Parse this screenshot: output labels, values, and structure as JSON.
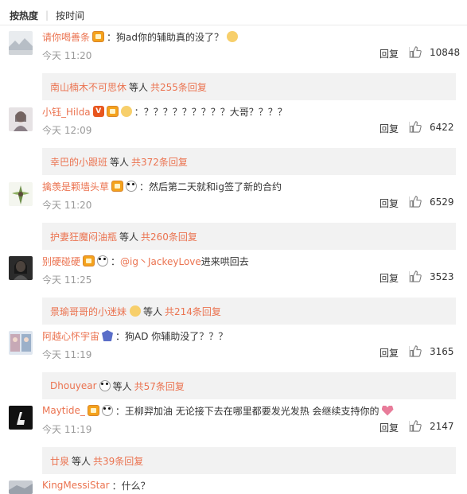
{
  "sort": {
    "hot": "按热度",
    "time": "按时间"
  },
  "reply_label": "回复",
  "comments": [
    {
      "username": "请你喝善条",
      "badges": [
        "vip-icon"
      ],
      "separator": "：",
      "text": "狗ad你的辅助真的没了？",
      "trailing_icon": "crying-emoji-icon",
      "time": "今天 11:20",
      "likes": "10848",
      "sub": {
        "names": "南山楠木不可思休",
        "mid": "等人",
        "count": "共255条回复",
        "emoji": ""
      }
    },
    {
      "username": "小钰_Hilda",
      "badges": [
        "v-verified-icon",
        "vip-icon",
        "star-badge-icon"
      ],
      "separator": "：",
      "text": "？？？？？？？？？大哥？？？？",
      "trailing_icon": "",
      "time": "今天 12:09",
      "likes": "6422",
      "sub": {
        "names": "幸巴的小跟班",
        "mid": "等人",
        "count": "共372条回复",
        "emoji": ""
      }
    },
    {
      "username": "擒羡是颗墙头草",
      "badges": [
        "vip-icon",
        "panda-icon"
      ],
      "separator": "：",
      "text": "然后第二天就和ig签了新的合约",
      "trailing_icon": "",
      "time": "今天 11:20",
      "likes": "6529",
      "sub": {
        "names": "护妻狂魔闷油瓶",
        "mid": "等人",
        "count": "共260条回复",
        "emoji": ""
      }
    },
    {
      "username": "别硬碰硬",
      "badges": [
        "vip-icon",
        "panda-icon"
      ],
      "separator": "：",
      "mention": "@ig丶JackeyLove",
      "text": " 进来哄回去",
      "trailing_icon": "",
      "time": "今天 11:25",
      "likes": "3523",
      "sub": {
        "names": "景瑜哥哥的小迷妹",
        "mid": "等人",
        "count": "共214条回复",
        "emoji": "star-emoji-icon"
      }
    },
    {
      "username": "阿越心怀宇宙",
      "badges": [
        "shield-badge-icon"
      ],
      "separator": "：",
      "text": "狗AD 你辅助没了？？？",
      "trailing_icon": "",
      "time": "今天 11:19",
      "likes": "3165",
      "sub": {
        "names": "Dhouyear",
        "mid": "等人",
        "count": "共57条回复",
        "emoji": "panda-emoji-icon"
      }
    },
    {
      "username": "Maytide_",
      "badges": [
        "vip-icon",
        "panda-icon"
      ],
      "separator": "：",
      "text": "王柳羿加油 无论接下去在哪里都要发光发热 会继续支持你的",
      "trailing_icon": "heart-icon",
      "time": "今天 11:19",
      "likes": "2147",
      "sub": {
        "names": "廿泉",
        "mid": "等人",
        "count": "共39条回复",
        "emoji": ""
      }
    },
    {
      "username": "KingMessiStar",
      "badges": [],
      "separator": "：",
      "text": "什么？",
      "trailing_icon": ""
    }
  ],
  "colors": {
    "link": "#eb7350",
    "meta": "#999999",
    "subbox_bg": "#f2f2f2"
  }
}
